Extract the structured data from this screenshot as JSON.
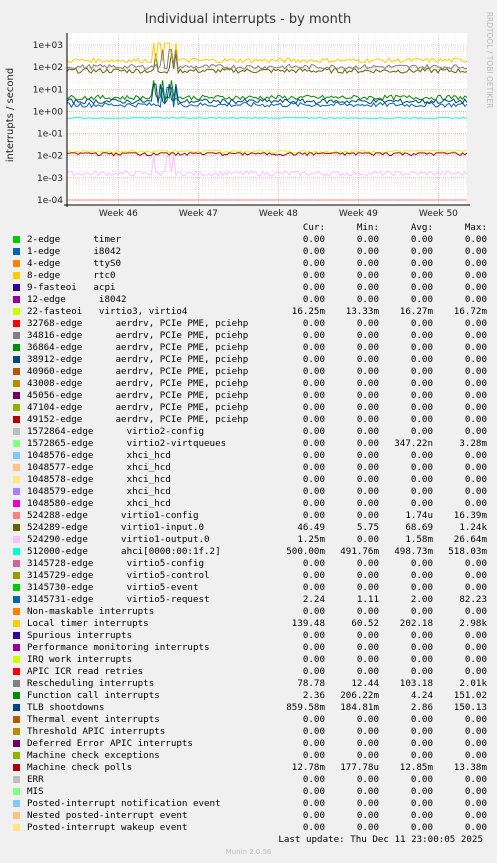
{
  "chart_data": {
    "type": "line",
    "title": "Individual interrupts - by month",
    "ylabel": "interrupts / second",
    "yscale": "log",
    "ylim": [
      0.0001,
      1000
    ],
    "yticks": [
      "1e+03",
      "1e+02",
      "1e+01",
      "1e+00",
      "1e-01",
      "1e-02",
      "1e-03",
      "1e-04"
    ],
    "xticks": [
      "Week 46",
      "Week 47",
      "Week 48",
      "Week 49",
      "Week 50"
    ],
    "grid": true,
    "side_text": "RRDTOOL / TOBI OETIKER",
    "columns": [
      "Cur:",
      "Min:",
      "Avg:",
      "Max:"
    ],
    "series": [
      {
        "name": "2-edge      timer",
        "color": "#00cc00",
        "cur": "0.00",
        "min": "0.00",
        "avg": "0.00",
        "max": "0.00"
      },
      {
        "name": "1-edge      i8042",
        "color": "#0066b3",
        "cur": "0.00",
        "min": "0.00",
        "avg": "0.00",
        "max": "0.00"
      },
      {
        "name": "4-edge      ttyS0",
        "color": "#ff8000",
        "cur": "0.00",
        "min": "0.00",
        "avg": "0.00",
        "max": "0.00"
      },
      {
        "name": "8-edge      rtc0",
        "color": "#ffcc00",
        "cur": "0.00",
        "min": "0.00",
        "avg": "0.00",
        "max": "0.00"
      },
      {
        "name": "9-fasteoi   acpi",
        "color": "#330099",
        "cur": "0.00",
        "min": "0.00",
        "avg": "0.00",
        "max": "0.00"
      },
      {
        "name": "12-edge      i8042",
        "color": "#990099",
        "cur": "0.00",
        "min": "0.00",
        "avg": "0.00",
        "max": "0.00"
      },
      {
        "name": "22-fasteoi   virtio3, virtio4",
        "color": "#ccff00",
        "cur": "16.25m",
        "min": "13.33m",
        "avg": "16.27m",
        "max": "16.72m"
      },
      {
        "name": "32768-edge      aerdrv, PCIe PME, pciehp",
        "color": "#ff0000",
        "cur": "0.00",
        "min": "0.00",
        "avg": "0.00",
        "max": "0.00"
      },
      {
        "name": "34816-edge      aerdrv, PCIe PME, pciehp",
        "color": "#808080",
        "cur": "0.00",
        "min": "0.00",
        "avg": "0.00",
        "max": "0.00"
      },
      {
        "name": "36864-edge      aerdrv, PCIe PME, pciehp",
        "color": "#008f00",
        "cur": "0.00",
        "min": "0.00",
        "avg": "0.00",
        "max": "0.00"
      },
      {
        "name": "38912-edge      aerdrv, PCIe PME, pciehp",
        "color": "#00487d",
        "cur": "0.00",
        "min": "0.00",
        "avg": "0.00",
        "max": "0.00"
      },
      {
        "name": "40960-edge      aerdrv, PCIe PME, pciehp",
        "color": "#b35a00",
        "cur": "0.00",
        "min": "0.00",
        "avg": "0.00",
        "max": "0.00"
      },
      {
        "name": "43008-edge      aerdrv, PCIe PME, pciehp",
        "color": "#b38f00",
        "cur": "0.00",
        "min": "0.00",
        "avg": "0.00",
        "max": "0.00"
      },
      {
        "name": "45056-edge      aerdrv, PCIe PME, pciehp",
        "color": "#6b006b",
        "cur": "0.00",
        "min": "0.00",
        "avg": "0.00",
        "max": "0.00"
      },
      {
        "name": "47104-edge      aerdrv, PCIe PME, pciehp",
        "color": "#8fb300",
        "cur": "0.00",
        "min": "0.00",
        "avg": "0.00",
        "max": "0.00"
      },
      {
        "name": "49152-edge      aerdrv, PCIe PME, pciehp",
        "color": "#b30000",
        "cur": "0.00",
        "min": "0.00",
        "avg": "0.00",
        "max": "0.00"
      },
      {
        "name": "1572864-edge      virtio2-config",
        "color": "#bebebe",
        "cur": "0.00",
        "min": "0.00",
        "avg": "0.00",
        "max": "0.00"
      },
      {
        "name": "1572865-edge      virtio2-virtqueues",
        "color": "#80ff80",
        "cur": "0.00",
        "min": "0.00",
        "avg": "347.22n",
        "max": "3.28m"
      },
      {
        "name": "1048576-edge      xhci_hcd",
        "color": "#80c9ff",
        "cur": "0.00",
        "min": "0.00",
        "avg": "0.00",
        "max": "0.00"
      },
      {
        "name": "1048577-edge      xhci_hcd",
        "color": "#ffc080",
        "cur": "0.00",
        "min": "0.00",
        "avg": "0.00",
        "max": "0.00"
      },
      {
        "name": "1048578-edge      xhci_hcd",
        "color": "#ffe680",
        "cur": "0.00",
        "min": "0.00",
        "avg": "0.00",
        "max": "0.00"
      },
      {
        "name": "1048579-edge      xhci_hcd",
        "color": "#aa80ff",
        "cur": "0.00",
        "min": "0.00",
        "avg": "0.00",
        "max": "0.00"
      },
      {
        "name": "1048580-edge      xhci_hcd",
        "color": "#ee00cc",
        "cur": "0.00",
        "min": "0.00",
        "avg": "0.00",
        "max": "0.00"
      },
      {
        "name": "524288-edge      virtio1-config",
        "color": "#ff8080",
        "cur": "0.00",
        "min": "0.00",
        "avg": "1.74u",
        "max": "16.39m"
      },
      {
        "name": "524289-edge      virtio1-input.0",
        "color": "#666600",
        "cur": "46.49",
        "min": "5.75",
        "avg": "68.69",
        "max": "1.24k"
      },
      {
        "name": "524290-edge      virtio1-output.0",
        "color": "#ffbfff",
        "cur": "1.25m",
        "min": "0.00",
        "avg": "1.58m",
        "max": "26.64m"
      },
      {
        "name": "512000-edge      ahci[0000:00:1f.2]",
        "color": "#00ffcc",
        "cur": "500.00m",
        "min": "491.76m",
        "avg": "498.73m",
        "max": "518.03m"
      },
      {
        "name": "3145728-edge      virtio5-config",
        "color": "#cc6699",
        "cur": "0.00",
        "min": "0.00",
        "avg": "0.00",
        "max": "0.00"
      },
      {
        "name": "3145729-edge      virtio5-control",
        "color": "#999900",
        "cur": "0.00",
        "min": "0.00",
        "avg": "0.00",
        "max": "0.00"
      },
      {
        "name": "3145730-edge      virtio5-event",
        "color": "#00cc00",
        "cur": "0.00",
        "min": "0.00",
        "avg": "0.00",
        "max": "0.00"
      },
      {
        "name": "3145731-edge      virtio5-request",
        "color": "#0066b3",
        "cur": "2.24",
        "min": "1.11",
        "avg": "2.00",
        "max": "82.23"
      },
      {
        "name": "Non-maskable interrupts",
        "color": "#ff8000",
        "cur": "0.00",
        "min": "0.00",
        "avg": "0.00",
        "max": "0.00"
      },
      {
        "name": "Local timer interrupts",
        "color": "#ffcc00",
        "cur": "139.48",
        "min": "60.52",
        "avg": "202.18",
        "max": "2.98k"
      },
      {
        "name": "Spurious interrupts",
        "color": "#330099",
        "cur": "0.00",
        "min": "0.00",
        "avg": "0.00",
        "max": "0.00"
      },
      {
        "name": "Performance monitoring interrupts",
        "color": "#990099",
        "cur": "0.00",
        "min": "0.00",
        "avg": "0.00",
        "max": "0.00"
      },
      {
        "name": "IRQ work interrupts",
        "color": "#ccff00",
        "cur": "0.00",
        "min": "0.00",
        "avg": "0.00",
        "max": "0.00"
      },
      {
        "name": "APIC ICR read retries",
        "color": "#ff0000",
        "cur": "0.00",
        "min": "0.00",
        "avg": "0.00",
        "max": "0.00"
      },
      {
        "name": "Rescheduling interrupts",
        "color": "#808080",
        "cur": "78.78",
        "min": "12.44",
        "avg": "103.18",
        "max": "2.01k"
      },
      {
        "name": "Function call interrupts",
        "color": "#008f00",
        "cur": "2.36",
        "min": "206.22m",
        "avg": "4.24",
        "max": "151.02"
      },
      {
        "name": "TLB shootdowns",
        "color": "#00487d",
        "cur": "859.58m",
        "min": "184.81m",
        "avg": "2.86",
        "max": "150.13"
      },
      {
        "name": "Thermal event interrupts",
        "color": "#b35a00",
        "cur": "0.00",
        "min": "0.00",
        "avg": "0.00",
        "max": "0.00"
      },
      {
        "name": "Threshold APIC interrupts",
        "color": "#b38f00",
        "cur": "0.00",
        "min": "0.00",
        "avg": "0.00",
        "max": "0.00"
      },
      {
        "name": "Deferred Error APIC interrupts",
        "color": "#6b006b",
        "cur": "0.00",
        "min": "0.00",
        "avg": "0.00",
        "max": "0.00"
      },
      {
        "name": "Machine check exceptions",
        "color": "#8fb300",
        "cur": "0.00",
        "min": "0.00",
        "avg": "0.00",
        "max": "0.00"
      },
      {
        "name": "Machine check polls",
        "color": "#b30000",
        "cur": "12.78m",
        "min": "177.78u",
        "avg": "12.85m",
        "max": "13.38m"
      },
      {
        "name": "ERR",
        "color": "#bebebe",
        "cur": "0.00",
        "min": "0.00",
        "avg": "0.00",
        "max": "0.00"
      },
      {
        "name": "MIS",
        "color": "#80ff80",
        "cur": "0.00",
        "min": "0.00",
        "avg": "0.00",
        "max": "0.00"
      },
      {
        "name": "Posted-interrupt notification event",
        "color": "#80c9ff",
        "cur": "0.00",
        "min": "0.00",
        "avg": "0.00",
        "max": "0.00"
      },
      {
        "name": "Nested posted-interrupt event",
        "color": "#ffc080",
        "cur": "0.00",
        "min": "0.00",
        "avg": "0.00",
        "max": "0.00"
      },
      {
        "name": "Posted-interrupt wakeup event",
        "color": "#ffe680",
        "cur": "0.00",
        "min": "0.00",
        "avg": "0.00",
        "max": "0.00"
      }
    ],
    "last_update": "Last update: Thu Dec 11 23:00:05 2025",
    "footer": "Munin 2.0.56"
  }
}
